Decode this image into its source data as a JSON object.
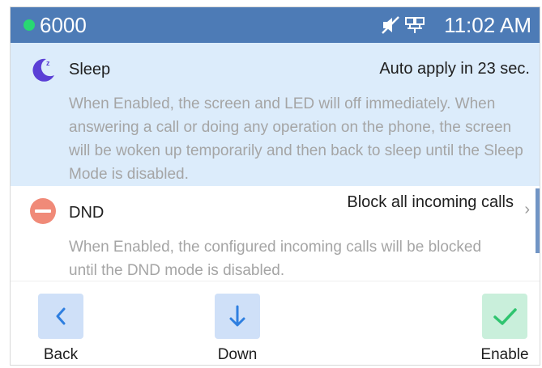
{
  "statusbar": {
    "account": "6000",
    "time": "11:02 AM",
    "icons": [
      "mute-icon",
      "network-icon"
    ],
    "account_status_color": "#28d873"
  },
  "modes": [
    {
      "title": "Sleep",
      "status": "Auto apply in 23 sec.",
      "description": "When Enabled, the screen and LED will off immediately. When answering a call or doing any operation on the phone, the screen will be woken up temporarily and then back to sleep until the Sleep Mode is disabled.",
      "icon": "moon-icon",
      "selected": true
    },
    {
      "title": "DND",
      "status": "Block all incoming calls",
      "description": "When Enabled, the configured incoming calls will be blocked until the DND mode is disabled.",
      "icon": "dnd-icon",
      "selected": false
    }
  ],
  "softkeys": {
    "back": "Back",
    "down": "Down",
    "enable": "Enable"
  },
  "colors": {
    "header": "#4d7bb6",
    "selected_row": "#dcecfb",
    "accent": "#2f7fe0",
    "enable": "#2fc46f",
    "dnd": "#f08a78",
    "moon": "#5b3fd6"
  }
}
